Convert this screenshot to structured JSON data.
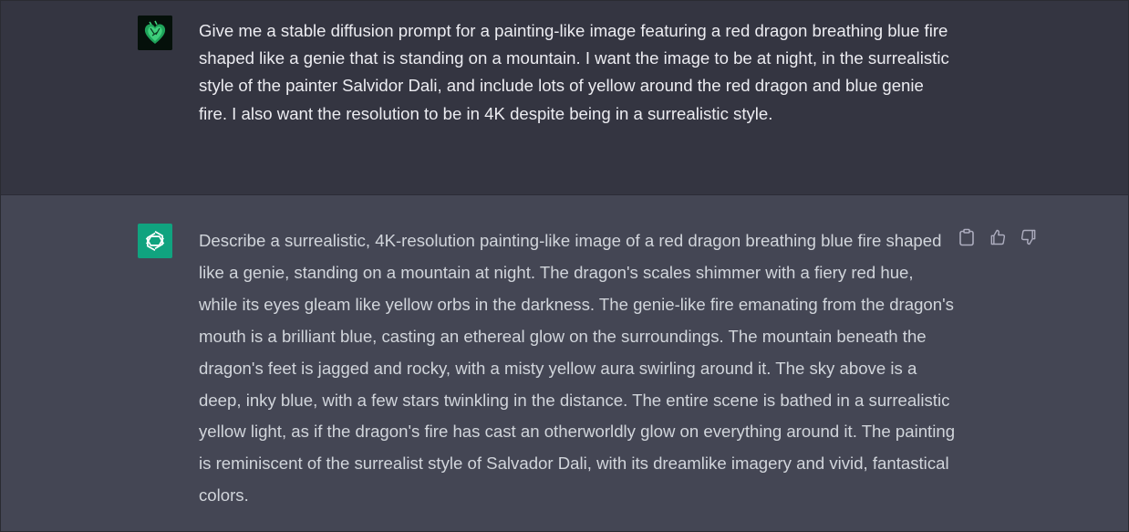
{
  "conversation": {
    "user_message": {
      "avatar_icon": "green-heart-icon",
      "text": "Give me a stable diffusion prompt for a painting-like image featuring a red dragon breathing blue fire shaped like a genie that is standing on a mountain. I want the image to be at night, in the surrealistic style of the painter Salvidor Dali, and include lots of yellow around the red dragon and blue genie fire. I also want the resolution to be in 4K despite being in a surrealistic style."
    },
    "assistant_message": {
      "avatar_icon": "openai-logo-icon",
      "text": "Describe a surrealistic, 4K-resolution painting-like image of a red dragon breathing blue fire shaped like a genie, standing on a mountain at night. The dragon's scales shimmer with a fiery red hue, while its eyes gleam like yellow orbs in the darkness. The genie-like fire emanating from the dragon's mouth is a brilliant blue, casting an ethereal glow on the surroundings. The mountain beneath the dragon's feet is jagged and rocky, with a misty yellow aura swirling around it. The sky above is a deep, inky blue, with a few stars twinkling in the distance. The entire scene is bathed in a surrealistic yellow light, as if the dragon's fire has cast an otherworldly glow on everything around it. The painting is reminiscent of the surrealist style of Salvador Dali, with its dreamlike imagery and vivid, fantastical colors.",
      "actions": [
        "clipboard-icon",
        "thumbs-up-icon",
        "thumbs-down-icon"
      ]
    }
  },
  "colors": {
    "user_bg": "#343541",
    "assistant_bg": "#444654",
    "text": "#ececf1",
    "brand": "#10a37f"
  }
}
